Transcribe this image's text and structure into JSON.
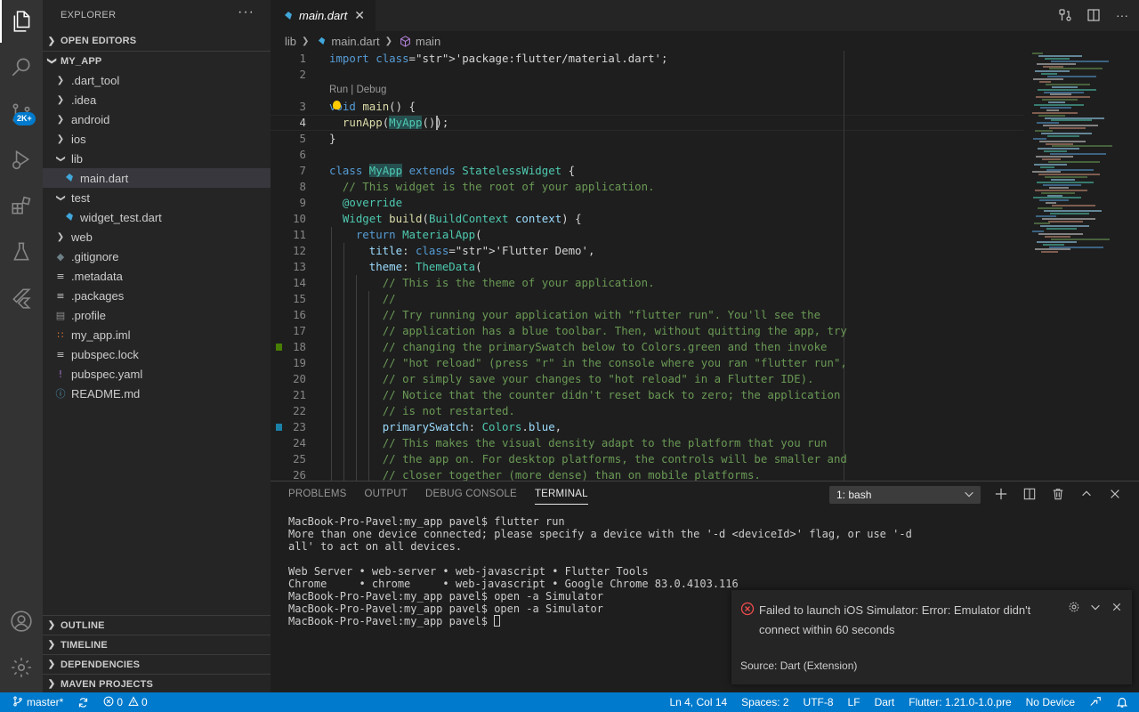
{
  "activity_bar": {
    "items": [
      "explorer-icon",
      "search-icon",
      "source-control-icon",
      "run-debug-icon",
      "extensions-icon",
      "testing-icon",
      "flutter-icon"
    ],
    "badge": "2K+",
    "bottom": [
      "account-icon",
      "manage-gear-icon"
    ]
  },
  "sidebar": {
    "title": "EXPLORER",
    "more": "···",
    "open_editors": "OPEN EDITORS",
    "project": "MY_APP",
    "tree": [
      {
        "label": ".dart_tool",
        "kind": "folder"
      },
      {
        "label": ".idea",
        "kind": "folder"
      },
      {
        "label": "android",
        "kind": "folder"
      },
      {
        "label": "ios",
        "kind": "folder"
      },
      {
        "label": "lib",
        "kind": "folder-open"
      },
      {
        "label": "main.dart",
        "kind": "dart"
      },
      {
        "label": "test",
        "kind": "folder-open"
      },
      {
        "label": "widget_test.dart",
        "kind": "dart"
      },
      {
        "label": "web",
        "kind": "folder"
      },
      {
        "label": ".gitignore",
        "kind": "git"
      },
      {
        "label": ".metadata",
        "kind": "text"
      },
      {
        "label": ".packages",
        "kind": "text"
      },
      {
        "label": ".profile",
        "kind": "profile"
      },
      {
        "label": "my_app.iml",
        "kind": "rss"
      },
      {
        "label": "pubspec.lock",
        "kind": "text"
      },
      {
        "label": "pubspec.yaml",
        "kind": "yaml"
      },
      {
        "label": "README.md",
        "kind": "info"
      }
    ],
    "outline": "OUTLINE",
    "timeline": "TIMELINE",
    "dependencies": "DEPENDENCIES",
    "maven": "MAVEN PROJECTS"
  },
  "tab": {
    "label": "main.dart",
    "close": "✕"
  },
  "breadcrumb": {
    "parts": [
      "lib",
      "main.dart",
      "main"
    ]
  },
  "editor": {
    "codelens": "Run | Debug",
    "line_numbers": [
      "1",
      "2",
      "3",
      "4",
      "5",
      "6",
      "7",
      "8",
      "9",
      "10",
      "11",
      "12",
      "13",
      "14",
      "15",
      "16",
      "17",
      "18",
      "19",
      "20",
      "21",
      "22",
      "23",
      "24",
      "25",
      "26"
    ],
    "lines": [
      "import 'package:flutter/material.dart';",
      "",
      "void main() {",
      "  runApp(MyApp());",
      "}",
      "",
      "class MyApp extends StatelessWidget {",
      "  // This widget is the root of your application.",
      "  @override",
      "  Widget build(BuildContext context) {",
      "    return MaterialApp(",
      "      title: 'Flutter Demo',",
      "      theme: ThemeData(",
      "        // This is the theme of your application.",
      "        //",
      "        // Try running your application with \"flutter run\". You'll see the",
      "        // application has a blue toolbar. Then, without quitting the app, try",
      "        // changing the primarySwatch below to Colors.green and then invoke",
      "        // \"hot reload\" (press \"r\" in the console where you ran \"flutter run\",",
      "        // or simply save your changes to \"hot reload\" in a Flutter IDE).",
      "        // Notice that the counter didn't reset back to zero; the application",
      "        // is not restarted.",
      "        primarySwatch: Colors.blue,",
      "        // This makes the visual density adapt to the platform that you run",
      "        // the app on. For desktop platforms, the controls will be smaller and",
      "        // closer together (more dense) than on mobile platforms."
    ],
    "colors": {
      "added": "#487e02",
      "modified": "#1b81a8"
    }
  },
  "panel": {
    "tabs": [
      "PROBLEMS",
      "OUTPUT",
      "DEBUG CONSOLE",
      "TERMINAL"
    ],
    "terminal_select": "1: bash",
    "terminal_lines": [
      "MacBook-Pro-Pavel:my_app pavel$ flutter run",
      "More than one device connected; please specify a device with the '-d <deviceId>' flag, or use '-d",
      "all' to act on all devices.",
      "",
      "Web Server • web-server • web-javascript • Flutter Tools",
      "Chrome     • chrome     • web-javascript • Google Chrome 83.0.4103.116",
      "MacBook-Pro-Pavel:my_app pavel$ open -a Simulator",
      "MacBook-Pro-Pavel:my_app pavel$ open -a Simulator",
      "MacBook-Pro-Pavel:my_app pavel$ "
    ]
  },
  "notification": {
    "message": "Failed to launch iOS Simulator: Error: Emulator didn't connect within 60 seconds",
    "source": "Source: Dart (Extension)"
  },
  "statusbar": {
    "branch": "master*",
    "errors": "0",
    "warnings": "0",
    "position": "Ln 4, Col 14",
    "spaces": "Spaces: 2",
    "encoding": "UTF-8",
    "eol": "LF",
    "language": "Dart",
    "flutter": "Flutter: 1.21.0-1.0.pre",
    "device": "No Device"
  }
}
